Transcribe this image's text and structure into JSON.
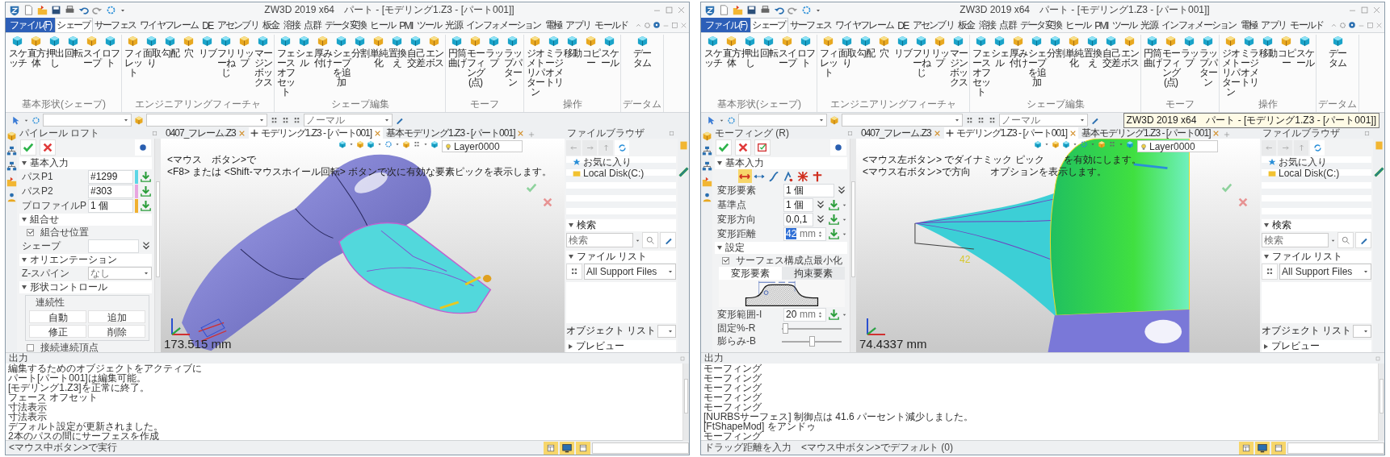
{
  "windows": [
    {
      "title": "ZW3D 2019 x64　パート - [モデリング1.Z3 - [パート001]]",
      "menu_tabs": [
        {
          "label": "ファイル(F)",
          "kind": "file",
          "selected": false
        },
        {
          "label": "シェープ",
          "kind": "tab",
          "selected": true
        },
        {
          "label": "サーフェス",
          "kind": "tab",
          "selected": false
        },
        {
          "label": "ワイヤフレーム",
          "kind": "tab",
          "selected": false
        },
        {
          "label": "DE",
          "kind": "tab",
          "selected": false
        },
        {
          "label": "アセンブリ",
          "kind": "tab",
          "selected": false
        },
        {
          "label": "板金",
          "kind": "tab",
          "selected": false
        },
        {
          "label": "溶接",
          "kind": "tab",
          "selected": false
        },
        {
          "label": "点群",
          "kind": "tab",
          "selected": false
        },
        {
          "label": "データ変換",
          "kind": "tab",
          "selected": false
        },
        {
          "label": "ヒール",
          "kind": "tab",
          "selected": false
        },
        {
          "label": "PMI",
          "kind": "tab",
          "selected": false
        },
        {
          "label": "ツール",
          "kind": "tab",
          "selected": false
        },
        {
          "label": "光源",
          "kind": "tab",
          "selected": false
        },
        {
          "label": "インフォメーション",
          "kind": "tab",
          "selected": false
        },
        {
          "label": "電極",
          "kind": "tab",
          "selected": false
        },
        {
          "label": "アプリ",
          "kind": "tab",
          "selected": false
        },
        {
          "label": "モールド",
          "kind": "tab",
          "selected": false
        }
      ],
      "ribbon": [
        {
          "caption": "基本形状(シェープ)",
          "buttons": [
            "スケッチ",
            "直方体",
            "押出し",
            "回転",
            "スイープ",
            "ロフト"
          ]
        },
        {
          "caption": "エンジニアリングフィーチャ",
          "buttons": [
            "フィレット",
            "面取り",
            "勾配",
            "穴",
            "リブ",
            "フリーねじ",
            "リップ",
            "マージンボックス"
          ]
        },
        {
          "caption": "シェープ編集",
          "buttons": [
            "フェースオフセット",
            "シェル",
            "厚み付け",
            "シェープを追加",
            "分割",
            "単純化",
            "置換え",
            "自己交差",
            "エンボス"
          ]
        },
        {
          "caption": "モーフ",
          "buttons": [
            "円筒曲げ",
            "モーフィング(点)",
            "ラップ",
            "ラップパターン"
          ]
        },
        {
          "caption": "操作",
          "buttons": [
            "ジオメトリパターン",
            "ミラージオメトリ",
            "移動",
            "コピー",
            "スケール"
          ]
        },
        {
          "caption": "データム",
          "buttons": [
            "データム"
          ]
        }
      ],
      "toolbar": {
        "style_value": "ノーマル"
      },
      "panel_title": "パイレール ロフト",
      "actions": [
        {
          "kind": "accept"
        },
        {
          "kind": "cancel"
        }
      ],
      "sections": [
        {
          "title": "基本入力",
          "expanded": true,
          "items": [
            {
              "kind": "field",
              "label": "パスP1",
              "value": "#1299",
              "color": "#5cd6e6",
              "pick": true
            },
            {
              "kind": "field",
              "label": "パスP2",
              "value": "#303",
              "color": "#e8a6e0",
              "pick": true
            },
            {
              "kind": "field",
              "label": "プロファイルP",
              "value": "1 個",
              "color": "#f0b030",
              "pick": true
            }
          ]
        },
        {
          "title": "組合せ",
          "expanded": true,
          "items": [
            {
              "kind": "check",
              "label": "組合せ位置",
              "checked": true
            },
            {
              "kind": "field",
              "label": "シェープ",
              "expand": true
            }
          ]
        },
        {
          "title": "オリエンテーション",
          "expanded": true,
          "items": [
            {
              "kind": "combo",
              "label": "Z-スパイン",
              "value": "なし"
            }
          ]
        },
        {
          "title": "形状コントロール",
          "expanded": true,
          "items": [
            {
              "kind": "group",
              "title": "連続性",
              "buttons": [
                "自動",
                "追加",
                "修正",
                "削除"
              ]
            },
            {
              "kind": "check",
              "label": "接続連続頂点",
              "checked": false
            }
          ]
        }
      ],
      "document_tabs": [
        {
          "label": "0407_フレーム.Z3",
          "selected": false
        },
        {
          "label": "モデリング1.Z3 - [パート001]",
          "selected": true
        },
        {
          "label": "基本モデリング1.Z3 - [パート001]",
          "selected": false
        }
      ],
      "viewport": {
        "model": {
          "kind": "pipe"
        },
        "prompt": [
          "<マウス　ボタン>で",
          "<F8> または <Shift-マウスホイール回転> ボタンで次に有効な要素ピックを表示します。"
        ],
        "layer": "Layer0000",
        "measure": "173.515 mm"
      },
      "browser": {
        "title": "ファイルブラウザ",
        "tree": [
          {
            "kind": "favorites",
            "label": "お気に入り"
          },
          {
            "kind": "drive",
            "label": "Local Disk(C:)"
          }
        ],
        "search": {
          "title": "検索",
          "expanded": true,
          "placeholder": "検索"
        },
        "file_list": {
          "title": "ファイル リスト",
          "expanded": true,
          "filter": "All Support Files"
        },
        "object_list": "オブジェクト リスト",
        "preview": {
          "title": "プレビュー",
          "expanded": false
        }
      },
      "output": {
        "title": "出力",
        "lines": [
          "編集するためのオブジェクトをアクティブに",
          "パート[パート001]は編集可能。",
          "[モデリング1.Z3]を正常に終了。",
          "フェース オフセット",
          "寸法表示",
          "寸法表示",
          "デフォルト設定が更新されました。",
          "2本のパスの間にサーフェスを作成"
        ]
      },
      "status": "<マウス中ボタン>で実行"
    },
    {
      "title": "ZW3D 2019 x64　パート - [モデリング1.Z3 - [パート001]]",
      "tooltip": "ZW3D 2019 x64　パート - [モデリング1.Z3 - [パート001]]",
      "menu_tabs": [
        {
          "label": "ファイル(F)",
          "kind": "file",
          "selected": false
        },
        {
          "label": "シェープ",
          "kind": "tab",
          "selected": true
        },
        {
          "label": "サーフェス",
          "kind": "tab",
          "selected": false
        },
        {
          "label": "ワイヤフレーム",
          "kind": "tab",
          "selected": false
        },
        {
          "label": "DE",
          "kind": "tab",
          "selected": false
        },
        {
          "label": "アセンブリ",
          "kind": "tab",
          "selected": false
        },
        {
          "label": "板金",
          "kind": "tab",
          "selected": false
        },
        {
          "label": "溶接",
          "kind": "tab",
          "selected": false
        },
        {
          "label": "点群",
          "kind": "tab",
          "selected": false
        },
        {
          "label": "データ変換",
          "kind": "tab",
          "selected": false
        },
        {
          "label": "ヒール",
          "kind": "tab",
          "selected": false
        },
        {
          "label": "PMI",
          "kind": "tab",
          "selected": false
        },
        {
          "label": "ツール",
          "kind": "tab",
          "selected": false
        },
        {
          "label": "光源",
          "kind": "tab",
          "selected": false
        },
        {
          "label": "インフォメーション",
          "kind": "tab",
          "selected": false
        },
        {
          "label": "電極",
          "kind": "tab",
          "selected": false
        },
        {
          "label": "アプリ",
          "kind": "tab",
          "selected": false
        },
        {
          "label": "モールド",
          "kind": "tab",
          "selected": false
        }
      ],
      "ribbon": [
        {
          "caption": "基本形状(シェープ)",
          "buttons": [
            "スケッチ",
            "直方体",
            "押出し",
            "回転",
            "スイープ",
            "ロフト"
          ]
        },
        {
          "caption": "エンジニアリングフィーチャ",
          "buttons": [
            "フィレット",
            "面取り",
            "勾配",
            "穴",
            "リブ",
            "フリーねじ",
            "リップ",
            "マージンボックス"
          ]
        },
        {
          "caption": "シェープ編集",
          "buttons": [
            "フェースオフセット",
            "シェル",
            "厚み付け",
            "シェープを追加",
            "分割",
            "単純化",
            "置換え",
            "自己交差",
            "エンボス"
          ]
        },
        {
          "caption": "モーフ",
          "buttons": [
            "円筒曲げ",
            "モーフィング(点)",
            "ラップ",
            "ラップパターン"
          ]
        },
        {
          "caption": "操作",
          "buttons": [
            "ジオメトリパターン",
            "ミラージオメトリ",
            "移動",
            "コピー",
            "スケール"
          ]
        },
        {
          "caption": "データム",
          "buttons": [
            "データム"
          ]
        }
      ],
      "toolbar": {
        "style_value": "ノーマル"
      },
      "panel_title": "モーフィング (R)",
      "actions": [
        {
          "kind": "accept"
        },
        {
          "kind": "cancel"
        },
        {
          "kind": "preview"
        }
      ],
      "sections": [
        {
          "title": "基本入力",
          "expanded": true,
          "items": [
            {
              "kind": "modes",
              "modes": [
                {
                  "selected": true
                },
                {
                  "selected": false
                },
                {
                  "selected": false
                },
                {
                  "selected": false
                },
                {
                  "selected": false
                },
                {
                  "selected": false
                }
              ]
            },
            {
              "kind": "field",
              "label": "変形要素",
              "value": "1 個",
              "expand": true
            },
            {
              "kind": "field",
              "label": "基準点",
              "value": "1 個",
              "expand": true,
              "pick": true,
              "menu": true
            },
            {
              "kind": "field",
              "label": "変形方向",
              "value": "0,0,1",
              "expand": true,
              "pick": true,
              "menu": true
            },
            {
              "kind": "field",
              "label": "変形距離",
              "value": "42",
              "highlighted": true,
              "unit": "mm",
              "spinner": true,
              "pick": true,
              "menu": true
            }
          ]
        },
        {
          "title": "設定",
          "expanded": true,
          "items": [
            {
              "kind": "check",
              "label": "サーフェス構成点最小化",
              "checked": true
            },
            {
              "kind": "tabs",
              "tabs": [
                {
                  "label": "変形要素",
                  "selected": true
                },
                {
                  "label": "拘束要素",
                  "selected": false
                }
              ]
            },
            {
              "kind": "diagram"
            },
            {
              "kind": "field",
              "label": "変形範囲-I",
              "value": "20",
              "unit": "mm",
              "spinner": true,
              "pick": true,
              "menu": true
            },
            {
              "kind": "slider",
              "label": "固定%-R",
              "level": 0.05
            },
            {
              "kind": "slider",
              "label": "膨らみ-B",
              "level": 0.5
            }
          ]
        }
      ],
      "document_tabs": [
        {
          "label": "0407_フレーム.Z3",
          "selected": false
        },
        {
          "label": "モデリング1.Z3 - [パート001]",
          "selected": true
        },
        {
          "label": "基本モデリング1.Z3 - [パート001]",
          "selected": false
        }
      ],
      "viewport": {
        "model": {
          "kind": "morph"
        },
        "prompt": [
          "<マウス左ボタン> でダイナミック ピック　　を有効にします。",
          "<マウス右ボタン>で方向　　オプションを表示します。"
        ],
        "layer": "Layer0000",
        "measure": "74.4337 mm",
        "dimension": "42"
      },
      "browser": {
        "title": "ファイルブラウザ",
        "tree": [
          {
            "kind": "favorites",
            "label": "お気に入り"
          },
          {
            "kind": "drive",
            "label": "Local Disk(C:)"
          }
        ],
        "search": {
          "title": "検索",
          "expanded": true,
          "placeholder": "検索"
        },
        "file_list": {
          "title": "ファイル リスト",
          "expanded": true,
          "filter": "All Support Files"
        },
        "object_list": "オブジェクト リスト",
        "preview": {
          "title": "プレビュー",
          "expanded": false
        }
      },
      "output": {
        "title": "出力",
        "lines": [
          "モーフィング",
          "モーフィング",
          "モーフィング",
          "モーフィング",
          "モーフィング",
          "[NURBSサーフェス] 制御点は 41.6 パーセント減少しました。",
          "[FtShapeMod] をアンドゥ",
          "モーフィング"
        ]
      },
      "status": "ドラッグ距離を入力　<マウス中ボタン>でデフォルト (0)"
    }
  ]
}
